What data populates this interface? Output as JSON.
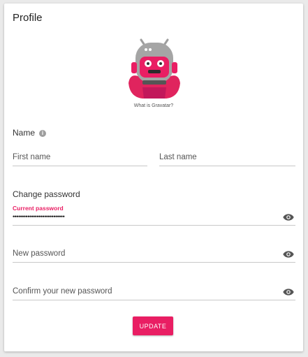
{
  "profile": {
    "title": "Profile",
    "gravatar_link": "What is Gravatar?",
    "name_label": "Name",
    "first_name_placeholder": "First name",
    "last_name_placeholder": "Last name"
  },
  "password": {
    "section_label": "Change password",
    "current_label": "Current password",
    "current_value": "••••••••••••••••••••••••••••",
    "new_placeholder": "New password",
    "confirm_placeholder": "Confirm your new password"
  },
  "actions": {
    "update_label": "UPDATE"
  },
  "colors": {
    "accent": "#e91e63",
    "avatar_gray": "#9e9e9e"
  },
  "icons": {
    "info": "info-icon",
    "visibility": "eye-icon"
  }
}
